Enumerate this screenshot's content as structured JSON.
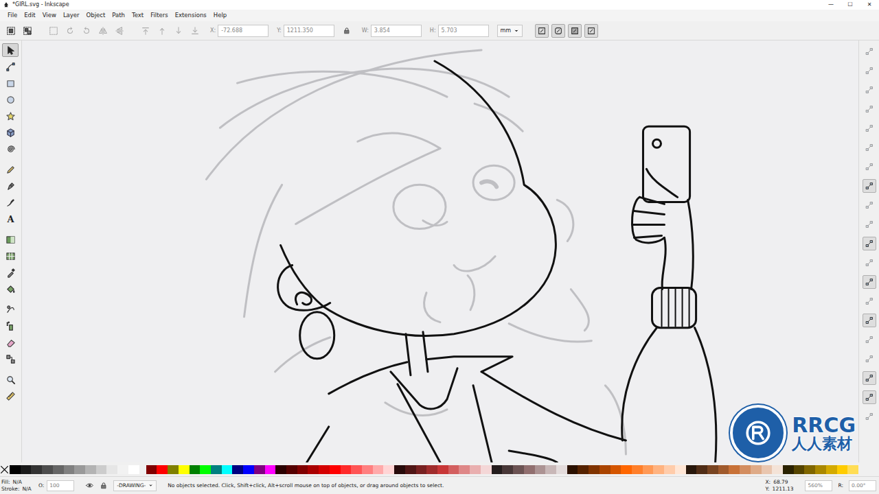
{
  "window": {
    "title": "*GIRL.svg - Inkscape",
    "controls": [
      "—",
      "☐",
      "✕"
    ]
  },
  "menu": [
    "File",
    "Edit",
    "View",
    "Layer",
    "Object",
    "Path",
    "Text",
    "Filters",
    "Extensions",
    "Help"
  ],
  "tool_controls": {
    "buttons": [
      {
        "kind": "select-all",
        "disabled": false
      },
      {
        "kind": "select-layers",
        "disabled": false
      },
      {
        "kind": "deselect",
        "disabled": true
      },
      {
        "kind": "rotate-ccw",
        "disabled": true
      },
      {
        "kind": "rotate-cw",
        "disabled": true
      },
      {
        "kind": "flip-h",
        "disabled": true
      },
      {
        "kind": "flip-v",
        "disabled": true
      },
      {
        "kind": "raise-top",
        "disabled": true
      },
      {
        "kind": "raise",
        "disabled": true
      },
      {
        "kind": "lower",
        "disabled": true
      },
      {
        "kind": "lower-bottom",
        "disabled": true
      }
    ],
    "fields": [
      {
        "label": "X:",
        "value": "-72.688"
      },
      {
        "label": "Y:",
        "value": "1211.350"
      },
      {
        "label": "W:",
        "value": "3.854"
      },
      {
        "label": "H:",
        "value": "5.703"
      }
    ],
    "lock": {
      "on": false
    },
    "unit": "mm",
    "toggles": [
      {
        "kind": "scale-stroke",
        "on": true
      },
      {
        "kind": "scale-corners",
        "on": true
      },
      {
        "kind": "move-gradients",
        "on": true
      },
      {
        "kind": "move-patterns",
        "on": true
      }
    ]
  },
  "tools": [
    {
      "kind": "selector",
      "selected": true
    },
    {
      "kind": "node",
      "selected": false
    },
    {
      "kind": "rect",
      "selected": false
    },
    {
      "kind": "ellipse",
      "selected": false
    },
    {
      "kind": "star",
      "selected": false
    },
    {
      "kind": "box3d",
      "selected": false
    },
    {
      "kind": "spiral",
      "selected": false
    },
    {
      "kind": "pencil",
      "selected": false
    },
    {
      "kind": "pen",
      "selected": false
    },
    {
      "kind": "calligraphy",
      "selected": false
    },
    {
      "kind": "text",
      "selected": false,
      "label": "A"
    },
    {
      "kind": "gradient",
      "selected": false
    },
    {
      "kind": "mesh",
      "selected": false
    },
    {
      "kind": "dropper",
      "selected": false
    },
    {
      "kind": "bucket",
      "selected": false
    },
    {
      "kind": "tweak",
      "selected": false
    },
    {
      "kind": "spray",
      "selected": false
    },
    {
      "kind": "eraser",
      "selected": false
    },
    {
      "kind": "connector",
      "selected": false
    },
    {
      "kind": "zoom",
      "selected": false
    },
    {
      "kind": "measure",
      "selected": false
    }
  ],
  "snap": [
    {
      "on": false
    },
    {
      "on": false
    },
    {
      "on": false
    },
    {
      "on": false
    },
    {
      "on": false
    },
    {
      "on": false
    },
    {
      "on": false
    },
    {
      "on": true
    },
    {
      "on": false
    },
    {
      "on": false
    },
    {
      "on": true
    },
    {
      "on": false
    },
    {
      "on": true
    },
    {
      "on": false
    },
    {
      "on": true
    },
    {
      "on": false
    },
    {
      "on": false
    },
    {
      "on": true
    },
    {
      "on": true
    },
    {
      "on": false
    }
  ],
  "palette": [
    {
      "color": "#000000"
    },
    {
      "color": "#1a1a1a"
    },
    {
      "color": "#333333"
    },
    {
      "color": "#4d4d4d"
    },
    {
      "color": "#666666"
    },
    {
      "color": "#808080"
    },
    {
      "color": "#999999"
    },
    {
      "color": "#b3b3b3"
    },
    {
      "color": "#cccccc"
    },
    {
      "color": "#e6e6e6"
    },
    {
      "color": "#f2f2f2"
    },
    {
      "color": "#ffffff"
    },
    {
      "color": "#800000"
    },
    {
      "color": "#ff0000"
    },
    {
      "color": "#808000"
    },
    {
      "color": "#ffff00"
    },
    {
      "color": "#008000"
    },
    {
      "color": "#00ff00"
    },
    {
      "color": "#008080"
    },
    {
      "color": "#00ffff"
    },
    {
      "color": "#000080"
    },
    {
      "color": "#0000ff"
    },
    {
      "color": "#800080"
    },
    {
      "color": "#ff00ff"
    },
    {
      "color": "#2b0000"
    },
    {
      "color": "#550000"
    },
    {
      "color": "#800000"
    },
    {
      "color": "#aa0000"
    },
    {
      "color": "#d40000"
    },
    {
      "color": "#ff0000"
    },
    {
      "color": "#ff2a2a"
    },
    {
      "color": "#ff5555"
    },
    {
      "color": "#ff8080"
    },
    {
      "color": "#ffaaaa"
    },
    {
      "color": "#ffd5d5"
    },
    {
      "color": "#280b0b"
    },
    {
      "color": "#501616"
    },
    {
      "color": "#782121"
    },
    {
      "color": "#a02c2c"
    },
    {
      "color": "#c83737"
    },
    {
      "color": "#d35f5f"
    },
    {
      "color": "#de8787"
    },
    {
      "color": "#e9afaf"
    },
    {
      "color": "#f4d7d7"
    },
    {
      "color": "#241c1c"
    },
    {
      "color": "#483737"
    },
    {
      "color": "#6c5353"
    },
    {
      "color": "#916f6f"
    },
    {
      "color": "#ac9393"
    },
    {
      "color": "#c8b7b7"
    },
    {
      "color": "#e3dbdb"
    },
    {
      "color": "#2b1100"
    },
    {
      "color": "#552200"
    },
    {
      "color": "#803300"
    },
    {
      "color": "#aa4400"
    },
    {
      "color": "#d45500"
    },
    {
      "color": "#ff6600"
    },
    {
      "color": "#ff7f2a"
    },
    {
      "color": "#ff9955"
    },
    {
      "color": "#ffb380"
    },
    {
      "color": "#ffccaa"
    },
    {
      "color": "#ffe6d5"
    },
    {
      "color": "#28170b"
    },
    {
      "color": "#502d16"
    },
    {
      "color": "#784421"
    },
    {
      "color": "#a05a2c"
    },
    {
      "color": "#c87137"
    },
    {
      "color": "#d38d5f"
    },
    {
      "color": "#deaa87"
    },
    {
      "color": "#e9c6af"
    },
    {
      "color": "#f4e3d7"
    },
    {
      "color": "#2b2200"
    },
    {
      "color": "#554400"
    },
    {
      "color": "#806600"
    },
    {
      "color": "#aa8800"
    },
    {
      "color": "#d4aa00"
    },
    {
      "color": "#ffcc00"
    },
    {
      "color": "#ffdd55"
    }
  ],
  "status": {
    "fill_label": "Fill:",
    "fill": "N/A",
    "stroke_label": "Stroke:",
    "stroke": "N/A",
    "opacity_label": "O:",
    "opacity": "100",
    "layer": "-DRAWING-",
    "message": "No objects selected. Click, Shift+click, Alt+scroll mouse on top of objects, or drag around objects to select.",
    "x_label": "X:",
    "x": "68.79",
    "y_label": "Y:",
    "y": "1211.13",
    "zoom": "560%",
    "rotation_label": "R:",
    "rotation": "0.00°"
  },
  "watermark": {
    "logo": "RRCG",
    "sub": "人人素材"
  }
}
